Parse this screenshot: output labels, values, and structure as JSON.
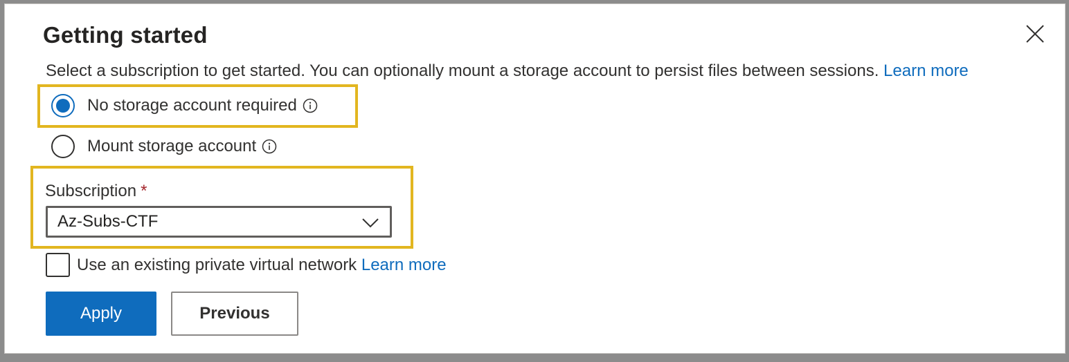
{
  "dialog": {
    "title": "Getting started",
    "description": "Select a subscription to get started. You can optionally mount a storage account to persist files between sessions.",
    "description_link": "Learn more",
    "close_icon": "close-icon"
  },
  "storage_options": [
    {
      "label": "No storage account required",
      "checked": true
    },
    {
      "label": "Mount storage account",
      "checked": false
    }
  ],
  "subscription": {
    "label": "Subscription",
    "required_marker": "*",
    "value": "Az-Subs-CTF"
  },
  "vnet": {
    "label": "Use an existing private virtual network",
    "link": "Learn more",
    "checked": false
  },
  "buttons": {
    "apply": "Apply",
    "previous": "Previous"
  },
  "colors": {
    "accent": "#0f6cbd",
    "highlight": "#e2b620",
    "required": "#a4262c"
  }
}
